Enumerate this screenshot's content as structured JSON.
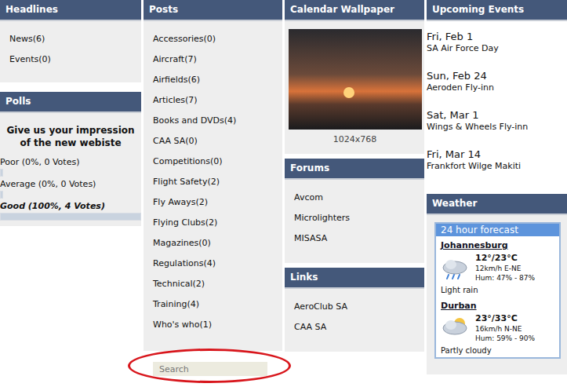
{
  "headlines": {
    "title": "Headlines",
    "items": [
      "News(6)",
      "Events(0)"
    ]
  },
  "polls": {
    "title": "Polls",
    "question": "Give us your impression of the new webiste",
    "options": [
      {
        "label": "Poor (0%, 0 Votes)",
        "level": 0,
        "leading": false
      },
      {
        "label": "Average (0%, 0 Votes)",
        "level": 0,
        "leading": false
      },
      {
        "label": "Good (100%, 4 Votes)",
        "level": 1,
        "leading": true
      }
    ]
  },
  "posts": {
    "title": "Posts",
    "items": [
      "Accessories(0)",
      "Aircraft(7)",
      "Airfields(6)",
      "Articles(7)",
      "Books and DVDs(4)",
      "CAA SA(0)",
      "Competitions(0)",
      "Flight Safety(2)",
      "Fly Aways(2)",
      "Flying Clubs(2)",
      "Magazines(0)",
      "Regulations(4)",
      "Technical(2)",
      "Training(4)",
      "Who's who(1)"
    ]
  },
  "search": {
    "placeholder": "Search"
  },
  "calendar": {
    "title": "Calendar Wallpaper",
    "caption": "1024x768"
  },
  "forums": {
    "title": "Forums",
    "items": [
      "Avcom",
      "Microlighters",
      "MISASA"
    ]
  },
  "links": {
    "title": "Links",
    "items": [
      "AeroClub SA",
      "CAA SA"
    ]
  },
  "events": {
    "title": "Upcoming Events",
    "items": [
      {
        "date": "Fri, Feb 1",
        "name": "SA Air Force Day"
      },
      {
        "date": "Sun, Feb 24",
        "name": "Aeroden Fly-inn"
      },
      {
        "date": "Sat, Mar 1",
        "name": "Wings & Wheels Fly-inn"
      },
      {
        "date": "Fri, Mar 14",
        "name": "Frankfort Wilge Makiti"
      }
    ]
  },
  "weather": {
    "title": "Weather",
    "widget_title": "24 hour forecast",
    "cities": [
      {
        "name": "Johannesburg",
        "temp": "12°/23°C",
        "wind": "12km/h E-NE",
        "humidity": "Hum: 47% - 87%",
        "summary": "Light rain",
        "kind": "rain"
      },
      {
        "name": "Durban",
        "temp": "23°/33°C",
        "wind": "16km/h N-NE",
        "humidity": "Hum: 59% - 90%",
        "summary": "Partly cloudy",
        "kind": "partly"
      }
    ]
  }
}
